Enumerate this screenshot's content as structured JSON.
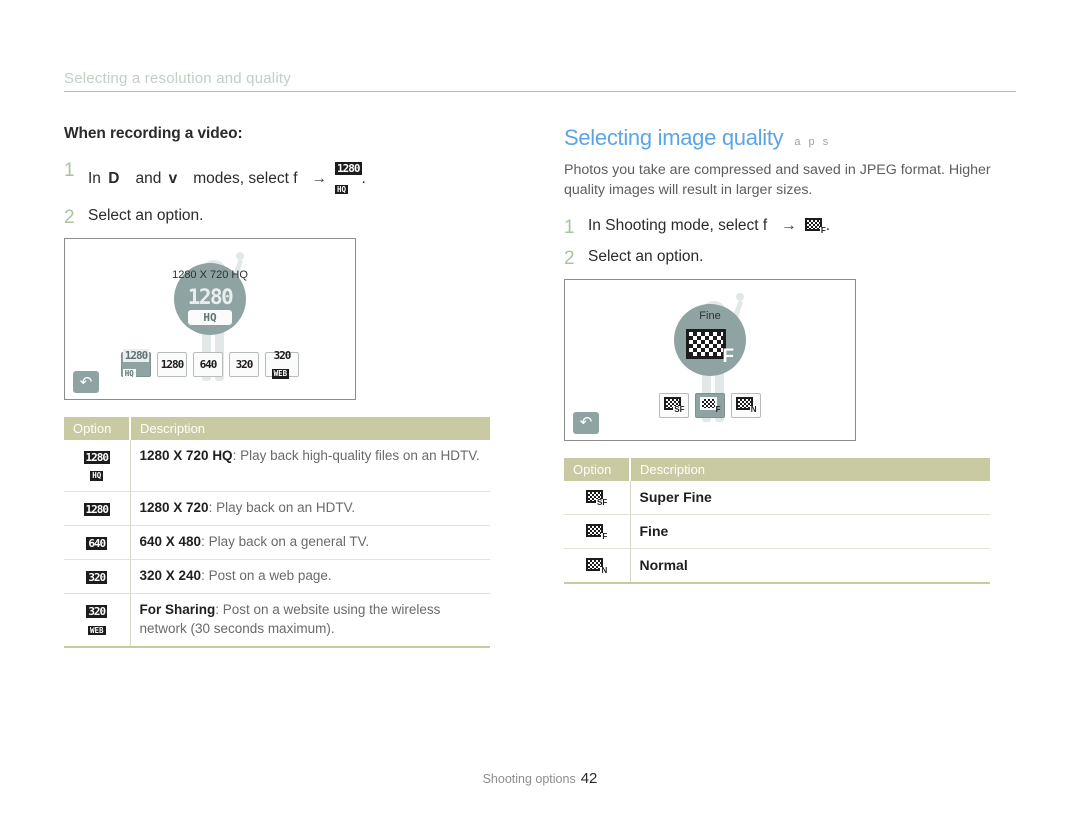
{
  "running_head": "Selecting a resolution and quality",
  "left": {
    "subheading": "When recording a video:",
    "steps": [
      {
        "num": "1",
        "pre": "In",
        "mode1": "D",
        "mid": "and",
        "mode2": "v",
        "post": "modes, select f",
        "arrow": "→",
        "trailing": "."
      },
      {
        "num": "2",
        "text": "Select an option."
      }
    ],
    "screen": {
      "badge_label": "1280 X 720 HQ",
      "badge_icon_top": "1280",
      "badge_icon_bottom": "HQ",
      "options": [
        {
          "top": "1280",
          "bottom": "HQ",
          "selected": true
        },
        {
          "top": "1280",
          "bottom": "",
          "selected": false
        },
        {
          "top": "640",
          "bottom": "",
          "selected": false
        },
        {
          "top": "320",
          "bottom": "",
          "selected": false
        },
        {
          "top": "320",
          "bottom": "WEB",
          "selected": false
        }
      ],
      "back_icon": "back-arrow-icon"
    },
    "table": {
      "header": {
        "option": "Option",
        "description": "Description"
      },
      "rows": [
        {
          "icon_top": "1280",
          "icon_bottom": "HQ",
          "title": "1280 X 720 HQ",
          "desc": ": Play back high-quality files on an HDTV."
        },
        {
          "icon_top": "1280",
          "icon_bottom": "",
          "title": "1280 X 720",
          "desc": ": Play back on an HDTV."
        },
        {
          "icon_top": "640",
          "icon_bottom": "",
          "title": "640 X 480",
          "desc": ": Play back on a general TV."
        },
        {
          "icon_top": "320",
          "icon_bottom": "",
          "title": "320 X 240",
          "desc": ": Post on a web page."
        },
        {
          "icon_top": "320",
          "icon_bottom": "WEB",
          "title": "For Sharing",
          "desc": ": Post on a website using the wireless network (30 seconds maximum)."
        }
      ]
    }
  },
  "right": {
    "title": "Selecting image quality",
    "modes": "a p s",
    "description": "Photos you take are compressed and saved in JPEG format. Higher quality images will result in larger sizes.",
    "steps": [
      {
        "num": "1",
        "pre": "In Shooting mode, select f",
        "arrow": "→",
        "trailing": "."
      },
      {
        "num": "2",
        "text": "Select an option."
      }
    ],
    "screen": {
      "badge_label": "Fine",
      "badge_icon_mark": "F",
      "options": [
        {
          "mark": "SF",
          "selected": false
        },
        {
          "mark": "F",
          "selected": true
        },
        {
          "mark": "N",
          "selected": false
        }
      ],
      "back_icon": "back-arrow-icon"
    },
    "table": {
      "header": {
        "option": "Option",
        "description": "Description"
      },
      "rows": [
        {
          "mark": "SF",
          "label": "Super Fine"
        },
        {
          "mark": "F",
          "label": "Fine"
        },
        {
          "mark": "N",
          "label": "Normal"
        }
      ]
    }
  },
  "footer": {
    "section": "Shooting options",
    "page": "42"
  },
  "colors": {
    "title_blue": "#5aa5e8",
    "table_header": "#c9c9a2",
    "step_number": "#a9c3a0",
    "badge_teal": "#8fa3a3",
    "runhead": "#c2cfc4"
  }
}
